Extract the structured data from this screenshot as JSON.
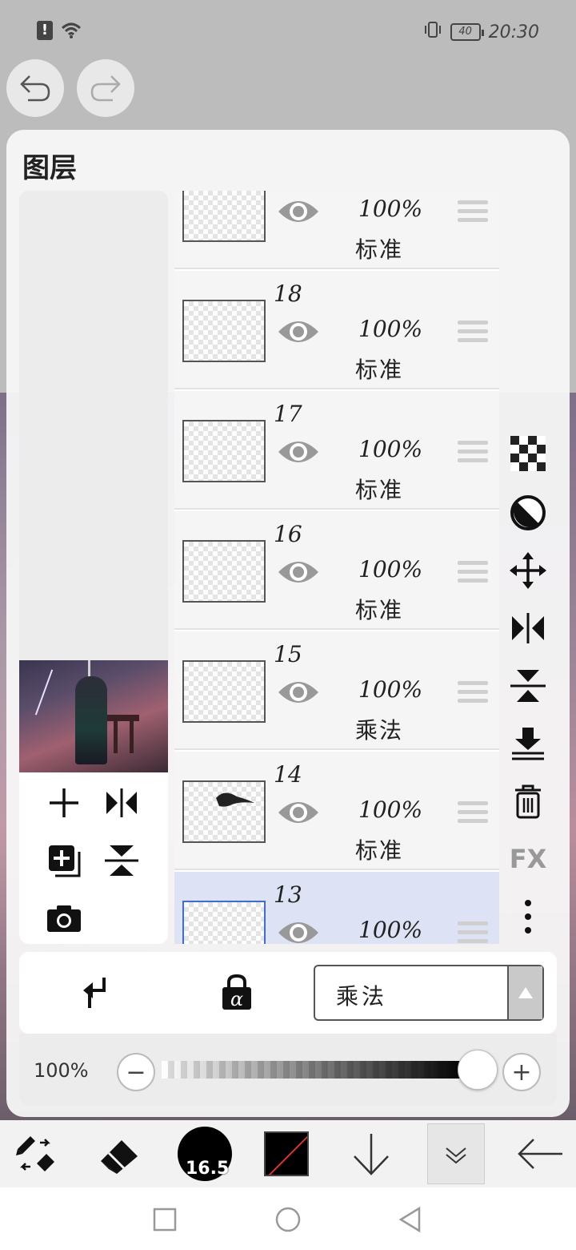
{
  "status_bar": {
    "alert_symbol": "!",
    "battery": "40",
    "time": "20:30"
  },
  "panel": {
    "title": "图层"
  },
  "layers": [
    {
      "number": "",
      "opacity": "100%",
      "blend": "标准",
      "visible": true,
      "selected": false
    },
    {
      "number": "18",
      "opacity": "100%",
      "blend": "标准",
      "visible": true,
      "selected": false
    },
    {
      "number": "17",
      "opacity": "100%",
      "blend": "标准",
      "visible": true,
      "selected": false
    },
    {
      "number": "16",
      "opacity": "100%",
      "blend": "标准",
      "visible": true,
      "selected": false
    },
    {
      "number": "15",
      "opacity": "100%",
      "blend": "乘法",
      "visible": true,
      "selected": false
    },
    {
      "number": "14",
      "opacity": "100%",
      "blend": "标准",
      "visible": true,
      "selected": false
    },
    {
      "number": "13",
      "opacity": "100%",
      "blend": "",
      "visible": true,
      "selected": true
    }
  ],
  "right_tools": {
    "fx_label": "FX"
  },
  "blend_bar": {
    "selected_mode": "乘法"
  },
  "opacity_bar": {
    "label": "100%",
    "minus": "−",
    "plus": "+",
    "value": 1.0
  },
  "bottom_toolbar": {
    "brush_size": "16.5",
    "primary_color": "#000000"
  },
  "colors": {
    "accent_selected": "#dde3f5",
    "selected_border": "#3a6fd0"
  }
}
